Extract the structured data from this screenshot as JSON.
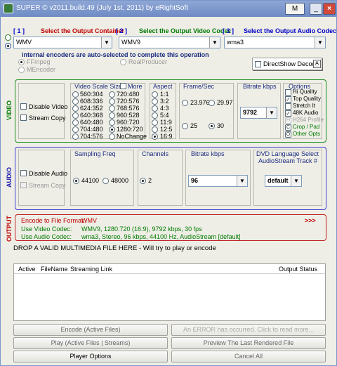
{
  "window": {
    "title": "SUPER © v2011.build.49 (July 1st, 2011) by eRightSoft",
    "m_btn": "M",
    "min_btn": "_",
    "close_btn": "×"
  },
  "header": {
    "num1": "1",
    "label1": "Select the Output Container",
    "num2": "2",
    "label2": "Select the Output Video Codec",
    "num3": "3",
    "label3": "Select the Output Audio Codec"
  },
  "selects": {
    "container": "WMV",
    "video_codec": "WMV9",
    "audio_codec": "wma3"
  },
  "encoders": {
    "title": "internal encoders are auto-selected to complete this operation",
    "ffmpeg": "FFmpeg",
    "mencoder": "MEncoder",
    "realproducer": "RealProducer",
    "directshow": "DirectShow Decode"
  },
  "video": {
    "section": "VIDEO",
    "disable": "Disable Video",
    "stream_copy": "Stream Copy",
    "scale_title": "Video Scale Size",
    "more": "More",
    "scale_col1": [
      "560:304",
      "608:336",
      "624:352",
      "640:368",
      "640:480",
      "704:480",
      "704:576"
    ],
    "scale_col2": [
      "720:480",
      "720:576",
      "768:576",
      "960:528",
      "960:720",
      "1280:720",
      "NoChange"
    ],
    "aspect_title": "Aspect",
    "aspects": [
      "1:1",
      "3:2",
      "4:3",
      "5:4",
      "11:9",
      "12:5",
      "16:9"
    ],
    "fps_title": "Frame/Sec",
    "fps": [
      "23.976",
      "29.97",
      "25",
      "30"
    ],
    "bitrate_title": "Bitrate  kbps",
    "bitrate": "9792",
    "options_title": "Options",
    "options": [
      "Hi Quality",
      "Top Quality",
      "Stretch It",
      "48K Audio",
      "H264 Profile",
      "Crop / Pad",
      "Other Opts"
    ],
    "options_letters": [
      "H",
      "C",
      "O"
    ]
  },
  "audio": {
    "section": "AUDIO",
    "disable": "Disable Audio",
    "stream_copy": "Stream Copy",
    "freq_title": "Sampling Freq",
    "freq": [
      "44100",
      "48000"
    ],
    "channels_title": "Channels",
    "channels": [
      "2"
    ],
    "bitrate_title": "Bitrate  kbps",
    "bitrate": "96",
    "dvd_title": "DVD Language Select",
    "dvd_sub": "AudioStream  Track #",
    "dvd_value": "default"
  },
  "output": {
    "section": "OUTPUT",
    "row1_label": "Encode to File Format:",
    "row1_value": "WMV",
    "row2_label": "Use Video Codec:",
    "row2_value": "WMV9,   1280:720 (16:9),   9792 kbps,   30 fps",
    "row3_label": "Use Audio Codec:",
    "row3_value": "wma3,   Stereo,   96 kbps,   44100 Hz,   AudioStream [default]",
    "more": ">>>"
  },
  "drop": "DROP A VALID MULTIMEDIA FILE HERE - Will try to play or encode",
  "file_table": {
    "columns": [
      "Active",
      "FileName",
      "Streaming Link",
      "Output Status"
    ]
  },
  "buttons": {
    "encode": "Encode (Active Files)",
    "error": "An ERROR has occurred. Click to read more...",
    "play": "Play (Active Files | Streams)",
    "preview": "Preview The Last Rendered File",
    "player_options": "Player Options",
    "cancel": "Cancel All"
  },
  "colors": {
    "title_bar": "#7d98cc",
    "video_border": "#1c8c1c",
    "audio_border": "#3c3cd0",
    "output_border": "#c02020",
    "accent_green": "#007a00",
    "accent_red": "#c00000"
  }
}
